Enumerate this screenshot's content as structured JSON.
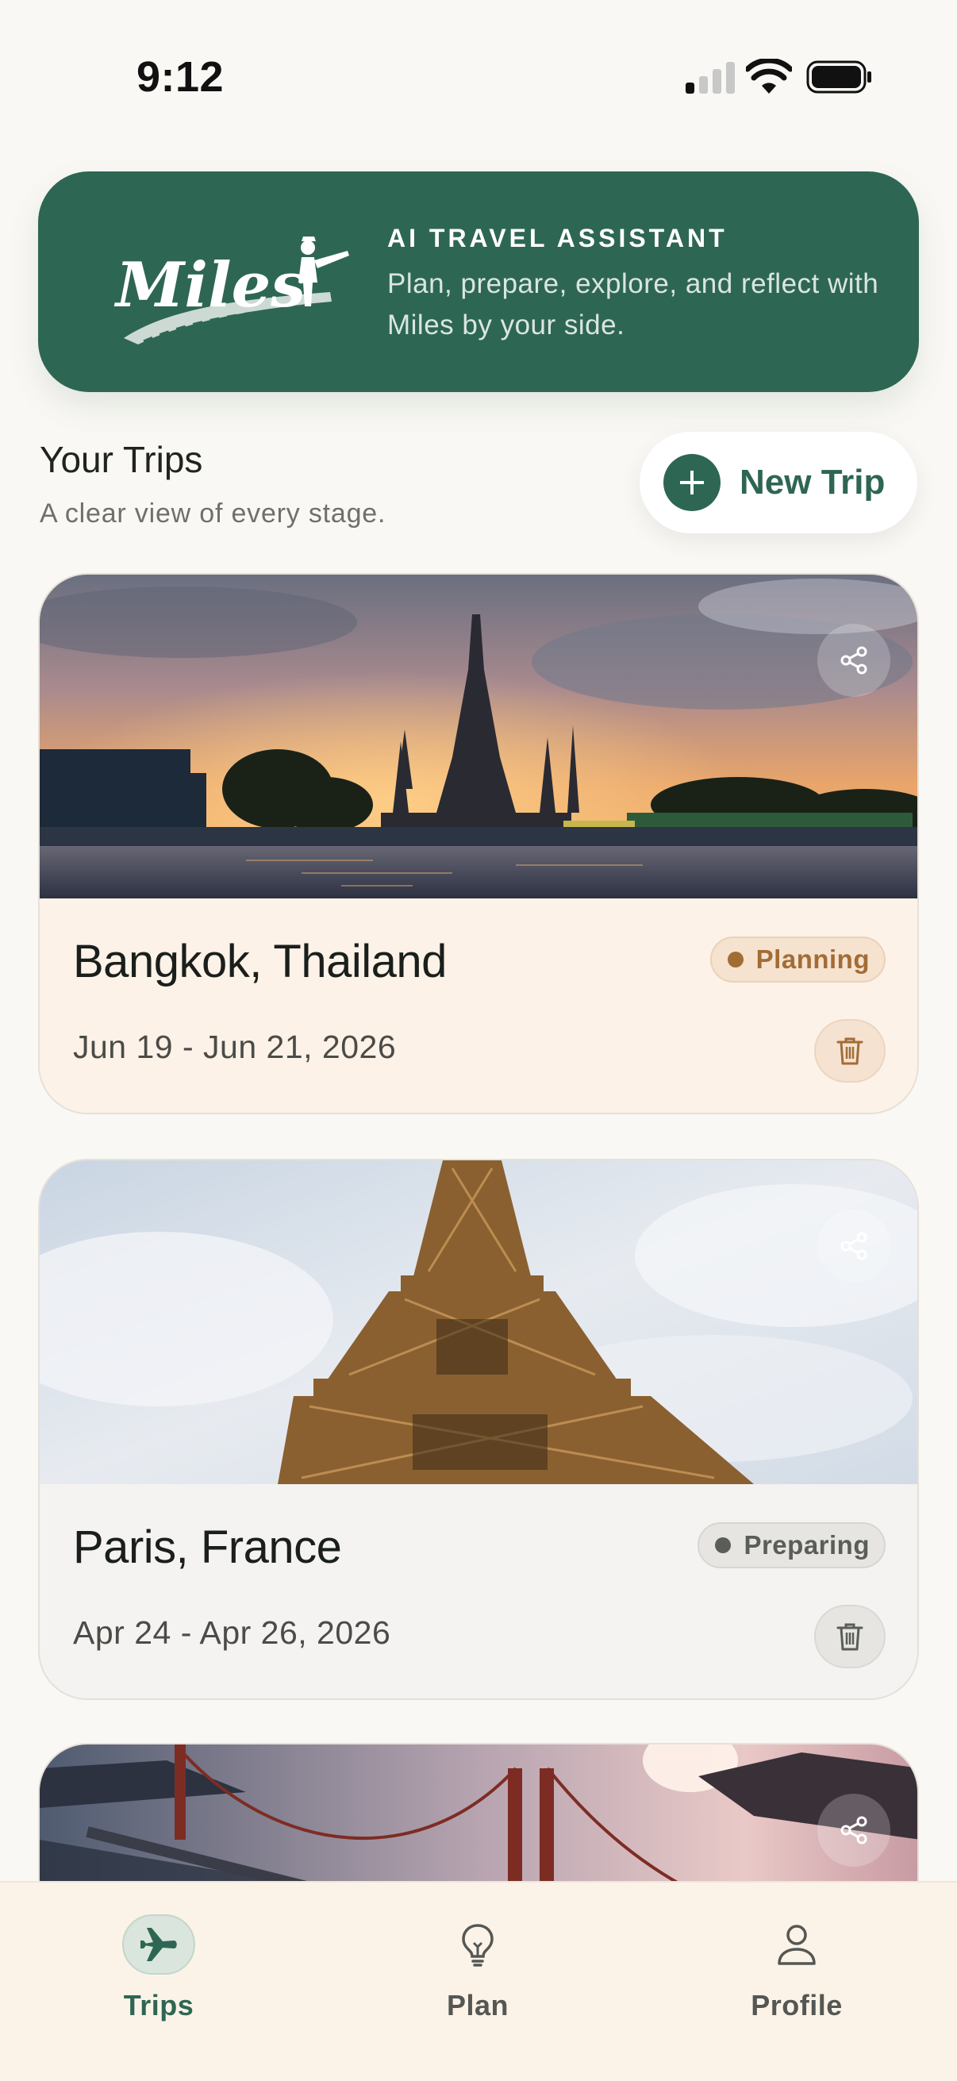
{
  "status_bar": {
    "time": "9:12"
  },
  "banner": {
    "logo_text": "Miles",
    "kicker": "AI TRAVEL ASSISTANT",
    "tagline": "Plan, prepare, explore, and reflect with Miles by your side."
  },
  "trips_section": {
    "title": "Your Trips",
    "subtitle": "A clear view of every stage.",
    "new_trip_label": "New Trip"
  },
  "trips": [
    {
      "name": "Bangkok, Thailand",
      "dates": "Jun 19 - Jun 21, 2026",
      "status": "Planning",
      "image": "temple-at-sunset"
    },
    {
      "name": "Paris, France",
      "dates": "Apr 24 - Apr 26, 2026",
      "status": "Preparing",
      "image": "eiffel-tower"
    },
    {
      "image": "golden-gate-bridge"
    }
  ],
  "tab_bar": {
    "tabs": [
      {
        "label": "Trips",
        "icon": "airplane-icon",
        "active": true
      },
      {
        "label": "Plan",
        "icon": "lightbulb-icon",
        "active": false
      },
      {
        "label": "Profile",
        "icon": "person-icon",
        "active": false
      }
    ]
  },
  "colors": {
    "brand_green": "#2e6654",
    "planning": "#a36c36",
    "preparing": "#5a5d59",
    "background": "#faf8f4"
  }
}
